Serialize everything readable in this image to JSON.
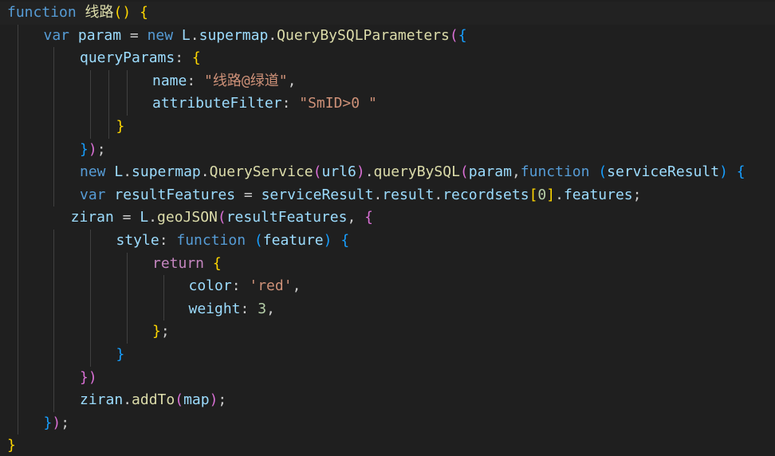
{
  "editor": {
    "colors": {
      "background": "#1f1f1f",
      "keyword": "#569cd6",
      "control": "#c586c0",
      "function": "#dcdcaa",
      "variable": "#9cdcfe",
      "string": "#ce9178",
      "number": "#b5cea8",
      "plain": "#cccccc",
      "bracket1": "#ffd700",
      "bracket2": "#da70d6",
      "bracket3": "#179fff",
      "indent_guide": "#404040"
    },
    "lines": [
      {
        "indent": 0,
        "tokens": [
          [
            "function",
            "keyword"
          ],
          [
            " ",
            "plain"
          ],
          [
            "线路",
            "function"
          ],
          [
            "()",
            "bracket1"
          ],
          [
            " ",
            "plain"
          ],
          [
            "{",
            "bracket1"
          ]
        ]
      },
      {
        "indent": 1,
        "tokens": [
          [
            "var",
            "keyword"
          ],
          [
            " ",
            "plain"
          ],
          [
            "param",
            "variable"
          ],
          [
            " = ",
            "plain"
          ],
          [
            "new",
            "keyword"
          ],
          [
            " ",
            "plain"
          ],
          [
            "L",
            "variable"
          ],
          [
            ".",
            "plain"
          ],
          [
            "supermap",
            "variable"
          ],
          [
            ".",
            "plain"
          ],
          [
            "QueryBySQLParameters",
            "function"
          ],
          [
            "(",
            "bracket2"
          ],
          [
            "{",
            "bracket3"
          ]
        ]
      },
      {
        "indent": 2,
        "tokens": [
          [
            "queryParams",
            "variable"
          ],
          [
            ": ",
            "plain"
          ],
          [
            "{",
            "bracket1"
          ]
        ]
      },
      {
        "indent": 4,
        "tokens": [
          [
            "name",
            "variable"
          ],
          [
            ": ",
            "plain"
          ],
          [
            "\"线路@绿道\"",
            "string"
          ],
          [
            ",",
            "plain"
          ]
        ]
      },
      {
        "indent": 4,
        "tokens": [
          [
            "attributeFilter",
            "variable"
          ],
          [
            ": ",
            "plain"
          ],
          [
            "\"SmID>0 \"",
            "string"
          ]
        ]
      },
      {
        "indent": 3,
        "tokens": [
          [
            "}",
            "bracket1"
          ]
        ]
      },
      {
        "indent": 2,
        "tokens": [
          [
            "}",
            "bracket3"
          ],
          [
            ")",
            "bracket2"
          ],
          [
            ";",
            "plain"
          ]
        ]
      },
      {
        "indent": 2,
        "tokens": [
          [
            "new",
            "keyword"
          ],
          [
            " ",
            "plain"
          ],
          [
            "L",
            "variable"
          ],
          [
            ".",
            "plain"
          ],
          [
            "supermap",
            "variable"
          ],
          [
            ".",
            "plain"
          ],
          [
            "QueryService",
            "function"
          ],
          [
            "(",
            "bracket2"
          ],
          [
            "url6",
            "variable"
          ],
          [
            ")",
            "bracket2"
          ],
          [
            ".",
            "plain"
          ],
          [
            "queryBySQL",
            "function"
          ],
          [
            "(",
            "bracket2"
          ],
          [
            "param",
            "variable"
          ],
          [
            ",",
            "plain"
          ],
          [
            "function",
            "keyword"
          ],
          [
            " ",
            "plain"
          ],
          [
            "(",
            "bracket3"
          ],
          [
            "serviceResult",
            "variable"
          ],
          [
            ")",
            "bracket3"
          ],
          [
            " ",
            "plain"
          ],
          [
            "{",
            "bracket3"
          ]
        ]
      },
      {
        "indent": 2,
        "tokens": [
          [
            "var",
            "keyword"
          ],
          [
            " ",
            "plain"
          ],
          [
            "resultFeatures",
            "variable"
          ],
          [
            " = ",
            "plain"
          ],
          [
            "serviceResult",
            "variable"
          ],
          [
            ".",
            "plain"
          ],
          [
            "result",
            "variable"
          ],
          [
            ".",
            "plain"
          ],
          [
            "recordsets",
            "variable"
          ],
          [
            "[",
            "bracket1"
          ],
          [
            "0",
            "number"
          ],
          [
            "]",
            "bracket1"
          ],
          [
            ".",
            "plain"
          ],
          [
            "features",
            "variable"
          ],
          [
            ";",
            "plain"
          ]
        ]
      },
      {
        "indent": 1.75,
        "tokens": [
          [
            "ziran",
            "variable"
          ],
          [
            " = ",
            "plain"
          ],
          [
            "L",
            "variable"
          ],
          [
            ".",
            "plain"
          ],
          [
            "geoJSON",
            "function"
          ],
          [
            "(",
            "bracket2"
          ],
          [
            "resultFeatures",
            "variable"
          ],
          [
            ", ",
            "plain"
          ],
          [
            "{",
            "bracket2"
          ]
        ]
      },
      {
        "indent": 3,
        "tokens": [
          [
            "style",
            "variable"
          ],
          [
            ": ",
            "plain"
          ],
          [
            "function",
            "keyword"
          ],
          [
            " ",
            "plain"
          ],
          [
            "(",
            "bracket3"
          ],
          [
            "feature",
            "variable"
          ],
          [
            ")",
            "bracket3"
          ],
          [
            " ",
            "plain"
          ],
          [
            "{",
            "bracket3"
          ]
        ]
      },
      {
        "indent": 4,
        "tokens": [
          [
            "return",
            "control"
          ],
          [
            " ",
            "plain"
          ],
          [
            "{",
            "bracket1"
          ]
        ]
      },
      {
        "indent": 5,
        "tokens": [
          [
            "color",
            "variable"
          ],
          [
            ": ",
            "plain"
          ],
          [
            "'red'",
            "string"
          ],
          [
            ",",
            "plain"
          ]
        ]
      },
      {
        "indent": 5,
        "tokens": [
          [
            "weight",
            "variable"
          ],
          [
            ": ",
            "plain"
          ],
          [
            "3",
            "number"
          ],
          [
            ",",
            "plain"
          ]
        ]
      },
      {
        "indent": 4,
        "tokens": [
          [
            "}",
            "bracket1"
          ],
          [
            ";",
            "plain"
          ]
        ]
      },
      {
        "indent": 3,
        "tokens": [
          [
            "}",
            "bracket3"
          ]
        ]
      },
      {
        "indent": 2,
        "tokens": [
          [
            "})",
            "bracket2"
          ]
        ]
      },
      {
        "indent": 2,
        "tokens": [
          [
            "ziran",
            "variable"
          ],
          [
            ".",
            "plain"
          ],
          [
            "addTo",
            "function"
          ],
          [
            "(",
            "bracket2"
          ],
          [
            "map",
            "variable"
          ],
          [
            ")",
            "bracket2"
          ],
          [
            ";",
            "plain"
          ]
        ]
      },
      {
        "indent": 1,
        "tokens": [
          [
            "}",
            "bracket3"
          ],
          [
            ")",
            "bracket2"
          ],
          [
            ";",
            "plain"
          ]
        ]
      },
      {
        "indent": 0,
        "tokens": [
          [
            "}",
            "bracket1"
          ]
        ]
      }
    ],
    "indent_guides": [
      [],
      [
        22
      ],
      [
        22,
        67
      ],
      [
        22,
        67,
        113,
        136,
        159
      ],
      [
        22,
        67,
        113,
        136,
        159
      ],
      [
        22,
        67,
        113,
        136
      ],
      [
        22,
        67
      ],
      [
        22,
        67
      ],
      [
        22,
        67
      ],
      [
        22
      ],
      [
        22,
        67,
        113
      ],
      [
        22,
        67,
        113,
        159
      ],
      [
        22,
        67,
        113,
        159,
        205
      ],
      [
        22,
        67,
        113,
        159,
        205
      ],
      [
        22,
        67,
        113,
        159
      ],
      [
        22,
        67,
        113
      ],
      [
        22,
        67
      ],
      [
        22,
        67
      ],
      [
        22
      ],
      []
    ]
  }
}
